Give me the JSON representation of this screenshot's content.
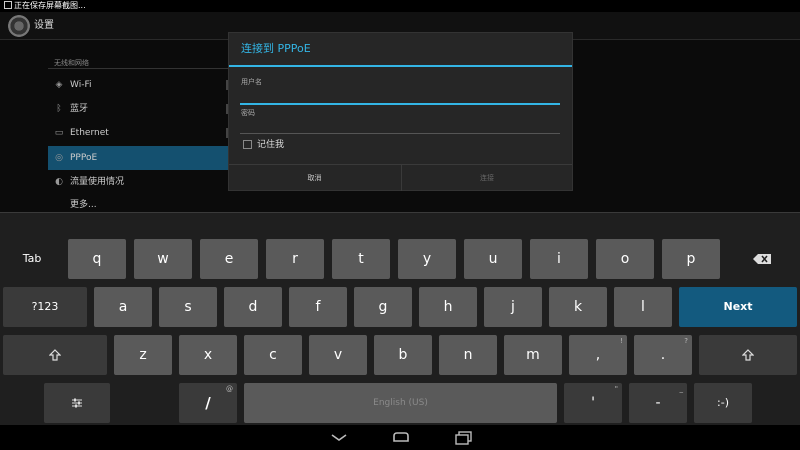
{
  "status_bar": {
    "text": "正在保存屏幕截图..."
  },
  "action_bar": {
    "title": "设置"
  },
  "settings": {
    "section": "无线和网络",
    "items": [
      {
        "icon": "wifi-icon",
        "glyph": "◈",
        "label": "Wi-Fi"
      },
      {
        "icon": "bluetooth-icon",
        "glyph": "ᛒ",
        "label": "蓝牙"
      },
      {
        "icon": "ethernet-icon",
        "glyph": "▭",
        "label": "Ethernet"
      },
      {
        "icon": "pppoe-icon",
        "glyph": "◎",
        "label": "PPPoE"
      },
      {
        "icon": "data-usage-icon",
        "glyph": "◐",
        "label": "流量使用情况"
      },
      {
        "icon": "",
        "glyph": "",
        "label": "更多..."
      }
    ]
  },
  "dialog": {
    "title": "连接到 PPPoE",
    "username_label": "用户名",
    "username_value": "",
    "password_label": "密码",
    "password_value": "",
    "remember_label": "记住我",
    "remember_checked": false,
    "cancel_label": "取消",
    "connect_label": "连接"
  },
  "keyboard": {
    "row1": {
      "tab": "Tab",
      "letters": [
        "q",
        "w",
        "e",
        "r",
        "t",
        "y",
        "u",
        "i",
        "o",
        "p"
      ]
    },
    "row2": {
      "sym": "?123",
      "letters": [
        "a",
        "s",
        "d",
        "f",
        "g",
        "h",
        "j",
        "k",
        "l"
      ],
      "next": "Next"
    },
    "row3": {
      "letters": [
        "z",
        "x",
        "c",
        "v",
        "b",
        "n",
        "m"
      ],
      "comma": ",",
      "comma_hint": "!",
      "period": ".",
      "period_hint": "?"
    },
    "row4": {
      "slash": "/",
      "slash_hint": "@",
      "space": "English (US)",
      "apostrophe": "'",
      "apostrophe_hint": "\"",
      "dash": "-",
      "dash_hint": "_",
      "emoji": ":-)"
    }
  },
  "colors": {
    "accent": "#33b5e5",
    "selected": "#14506f",
    "next_key": "#135a7f"
  }
}
